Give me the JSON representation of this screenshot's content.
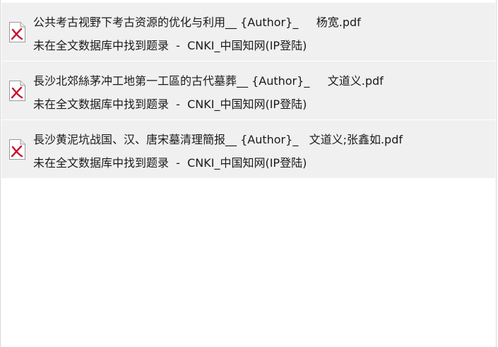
{
  "results": [
    {
      "title": "公共考古视野下考古资源的优化与利用__ {Author}_     杨宽.pdf",
      "status": "未在全文数据库中找到题录  -  CNKI_中国知网(IP登陆)",
      "icon": "pdf-file-icon"
    },
    {
      "title": "長沙北郊絲茅冲工地第一工區的古代墓葬__ {Author}_     文道义.pdf",
      "status": "未在全文数据库中找到题录  -  CNKI_中国知网(IP登陆)",
      "icon": "pdf-file-icon"
    },
    {
      "title": "長沙黄泥坑战国、汉、唐宋墓清理簡报__ {Author}_   文道义;张鑫如.pdf",
      "status": "未在全文数据库中找到题录  -  CNKI_中国知网(IP登陆)",
      "icon": "pdf-file-icon"
    }
  ],
  "colors": {
    "row_background": "#f0f0f0",
    "icon_red": "#c8102e",
    "text": "#1a1a1a"
  }
}
